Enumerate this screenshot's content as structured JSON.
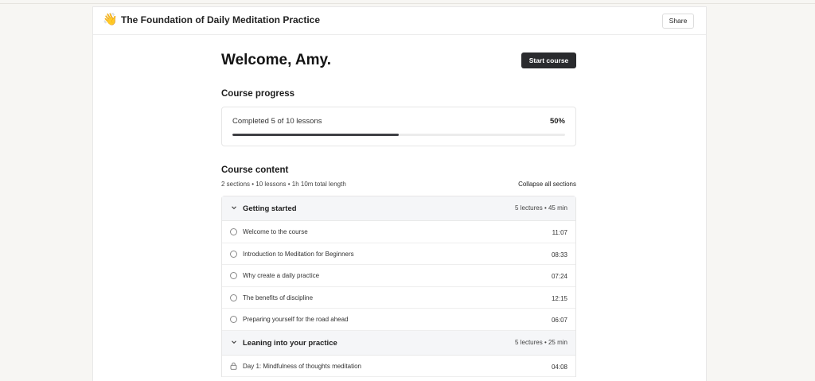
{
  "header": {
    "emoji": "👋",
    "title": "The Foundation of Daily Meditation Practice",
    "share_label": "Share"
  },
  "welcome": {
    "greeting": "Welcome, Amy.",
    "start_label": "Start course"
  },
  "progress": {
    "heading": "Course progress",
    "summary": "Completed 5 of 10 lessons",
    "percent_label": "50%",
    "fraction": 0.5
  },
  "course_content": {
    "heading": "Course content",
    "meta": "2 sections • 10 lessons • 1h 10m total length",
    "collapse_label": "Collapse all sections",
    "sections": [
      {
        "title": "Getting started",
        "meta": "5 lectures • 45 min",
        "lessons": [
          {
            "title": "Welcome to the course",
            "duration": "11:07",
            "icon": "circle-icon"
          },
          {
            "title": "Introduction to Meditation for Beginners",
            "duration": "08:33",
            "icon": "circle-icon"
          },
          {
            "title": "Why create a daily practice",
            "duration": "07:24",
            "icon": "circle-icon"
          },
          {
            "title": "The benefits of discipline",
            "duration": "12:15",
            "icon": "circle-icon"
          },
          {
            "title": "Preparing yourself for the road ahead",
            "duration": "06:07",
            "icon": "circle-icon"
          }
        ]
      },
      {
        "title": "Leaning into your practice",
        "meta": "5 lectures • 25 min",
        "lessons": [
          {
            "title": "Day 1: Mindfulness of thoughts meditation",
            "duration": "04:08",
            "icon": "lock-icon"
          }
        ]
      }
    ]
  },
  "colors": {
    "background": "#f7f6f3",
    "primary_button": "#2a2b2e",
    "progress_fill": "#3e3f44",
    "section_header": "#f5f6f8"
  }
}
